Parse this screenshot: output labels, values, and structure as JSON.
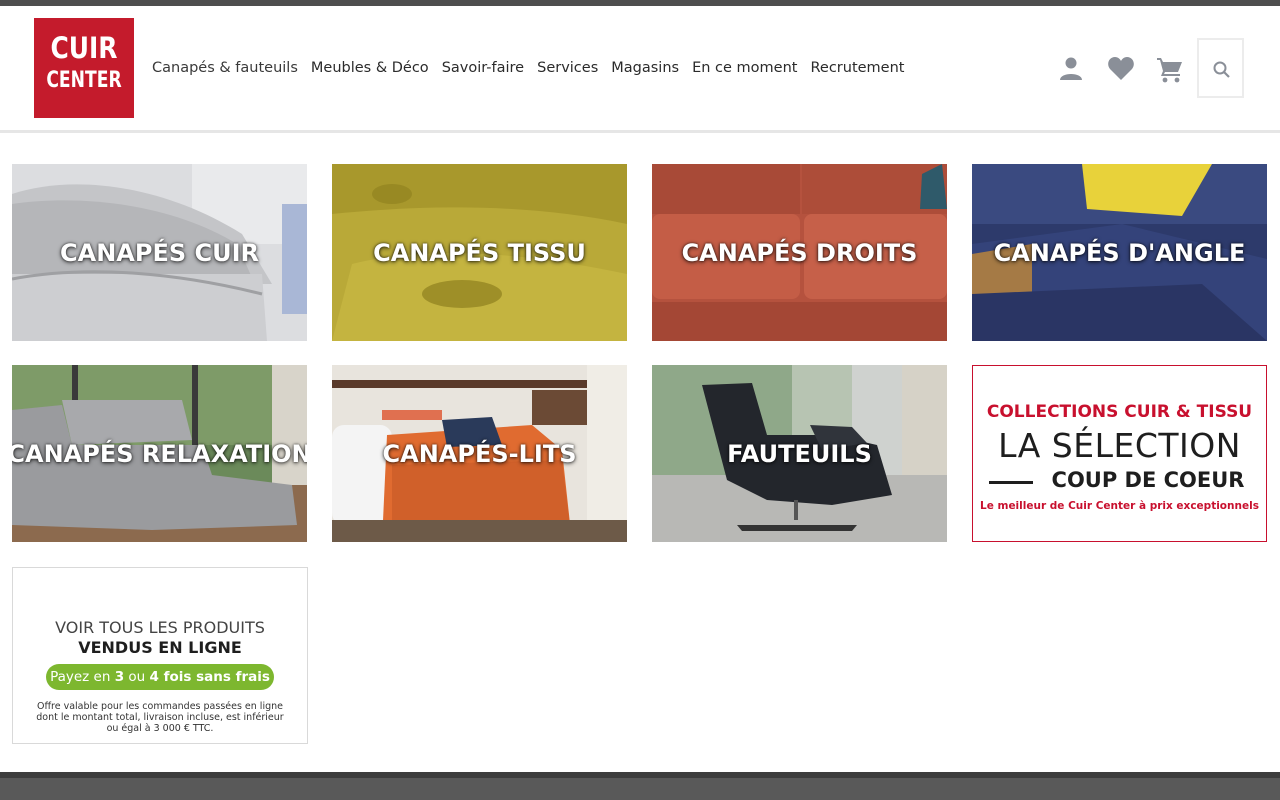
{
  "brand": {
    "line1": "CUIR",
    "line2": "CENTER",
    "color": "#c41b2c"
  },
  "nav": {
    "items": [
      {
        "label": "Canapés & fauteuils"
      },
      {
        "label": "Meubles & Déco"
      },
      {
        "label": "Savoir-faire"
      },
      {
        "label": "Services"
      },
      {
        "label": "Magasins"
      },
      {
        "label": "En ce moment"
      },
      {
        "label": "Recrutement"
      }
    ]
  },
  "header_icons": {
    "account": "user-icon",
    "wishlist": "heart-icon",
    "cart": "cart-icon",
    "search": "search-icon"
  },
  "categories": [
    {
      "label": "CANAPÉS CUIR"
    },
    {
      "label": "CANAPÉS TISSU"
    },
    {
      "label": "CANAPÉS DROITS"
    },
    {
      "label": "CANAPÉS D'ANGLE"
    },
    {
      "label": "CANAPÉS RELAXATION"
    },
    {
      "label": "CANAPÉS-LITS"
    },
    {
      "label": "FAUTEUILS"
    }
  ],
  "promo": {
    "line1": "COLLECTIONS CUIR & TISSU",
    "line2": "LA SÉLECTION",
    "line3": "COUP DE COEUR",
    "line4": "Le meilleur de Cuir Center à prix exceptionnels",
    "accent": "#c8102e"
  },
  "online": {
    "line1": "VOIR TOUS LES PRODUITS",
    "line2": "VENDUS EN LIGNE",
    "pill_pre": "Payez en ",
    "pill_n1": "3",
    "pill_mid": " ou ",
    "pill_n2": "4 fois sans frais",
    "note": "Offre valable pour les commandes passées en ligne dont le montant total, livraison incluse, est inférieur ou égal à 3 000 € TTC.",
    "pill_color": "#7db72f"
  }
}
